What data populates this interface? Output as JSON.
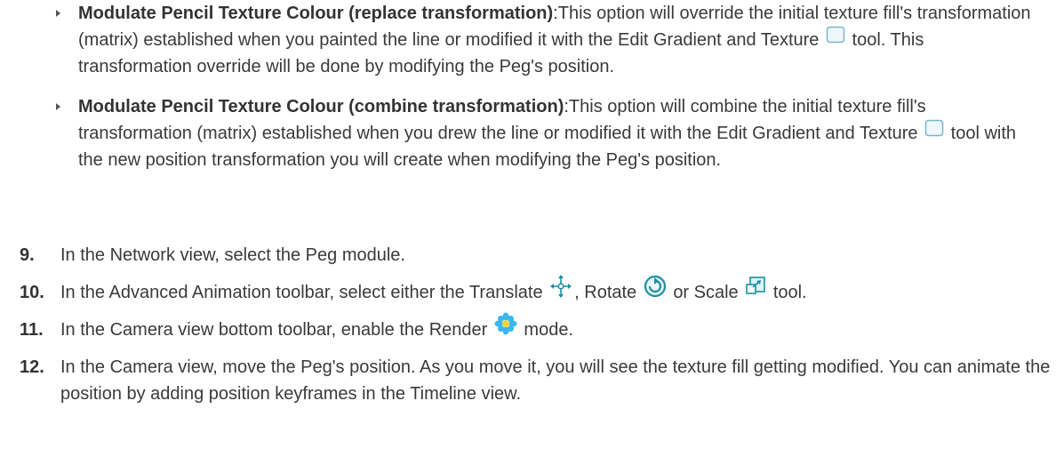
{
  "bullets": [
    {
      "title": "Modulate Pencil Texture Colour (replace transformation)",
      "text_a": ":This option will override the initial texture fill's transformation (matrix) established when you painted the line or modified it with the Edit Gradient and Texture",
      "text_b": "tool. This transformation override will be done by modifying the Peg's position.",
      "icon": "edit-gradient-texture-icon"
    },
    {
      "title": "Modulate Pencil Texture Colour (combine transformation)",
      "text_a": ":This option will combine the initial texture fill's transformation (matrix) established when you drew the line or modified it with the Edit Gradient and Texture",
      "text_b": "tool with the new position transformation you will create when modifying the Peg's position.",
      "icon": "edit-gradient-texture-icon"
    }
  ],
  "steps": [
    {
      "number": "9.",
      "text": "In the Network view, select the Peg module."
    },
    {
      "number": "10.",
      "text_a": "In the Advanced Animation toolbar, select either the Translate",
      "text_b": ", Rotate",
      "text_c": "or Scale",
      "text_d": "tool.",
      "icons": [
        "translate-icon",
        "rotate-icon",
        "scale-icon"
      ]
    },
    {
      "number": "11.",
      "text_a": "In the Camera view bottom toolbar, enable the Render",
      "text_b": "mode.",
      "icon": "render-icon"
    },
    {
      "number": "12.",
      "text": "In the Camera view, move the Peg's position. As you move it, you will see the texture fill getting modified. You can animate the position by adding position keyframes in the Timeline view."
    }
  ],
  "colors": {
    "text": "#3a3a3a",
    "icon_teal": "#1b8fa3",
    "icon_blue": "#5fc4ec",
    "render_flower": "#39b7f0"
  }
}
